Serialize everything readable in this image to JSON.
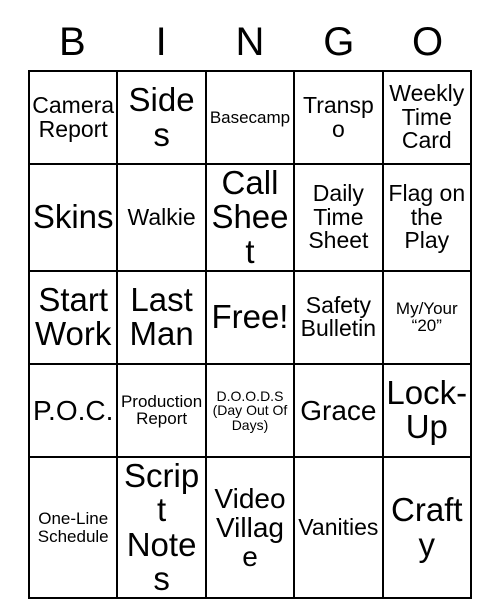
{
  "card": {
    "title": "BINGO",
    "header_letters": [
      "B",
      "I",
      "N",
      "G",
      "O"
    ],
    "rows": [
      [
        {
          "text": "Camera Report",
          "size": "md"
        },
        {
          "text": "Sides",
          "size": "xl"
        },
        {
          "text": "Basecamp",
          "size": "sm"
        },
        {
          "text": "Transpo",
          "size": "md"
        },
        {
          "text": "Weekly Time Card",
          "size": "md"
        }
      ],
      [
        {
          "text": "Skins",
          "size": "xl"
        },
        {
          "text": "Walkie",
          "size": "md"
        },
        {
          "text": "Call Sheet",
          "size": "xl"
        },
        {
          "text": "Daily Time Sheet",
          "size": "md"
        },
        {
          "text": "Flag on the Play",
          "size": "md"
        }
      ],
      [
        {
          "text": "Start Work",
          "size": "xl"
        },
        {
          "text": "Last Man",
          "size": "xl"
        },
        {
          "text": "Free!",
          "size": "xl"
        },
        {
          "text": "Safety Bulletin",
          "size": "md"
        },
        {
          "text": "My/Your “20”",
          "size": "sm"
        }
      ],
      [
        {
          "text": "P.O.C.",
          "size": "lg"
        },
        {
          "text": "Production Report",
          "size": "sm"
        },
        {
          "text": "D.O.O.D.S (Day Out Of Days)",
          "size": "xs"
        },
        {
          "text": "Grace",
          "size": "lg"
        },
        {
          "text": "Lock-Up",
          "size": "xl"
        }
      ],
      [
        {
          "text": "One-Line Schedule",
          "size": "sm"
        },
        {
          "text": "Script Notes",
          "size": "xl"
        },
        {
          "text": "Video Village",
          "size": "lg"
        },
        {
          "text": "Vanities",
          "size": "md"
        },
        {
          "text": "Crafty",
          "size": "xl"
        }
      ]
    ],
    "free_space": {
      "row": 2,
      "col": 2,
      "label": "Free!"
    },
    "colors": {
      "text": "#000000",
      "border": "#000000",
      "background": "#ffffff"
    }
  }
}
